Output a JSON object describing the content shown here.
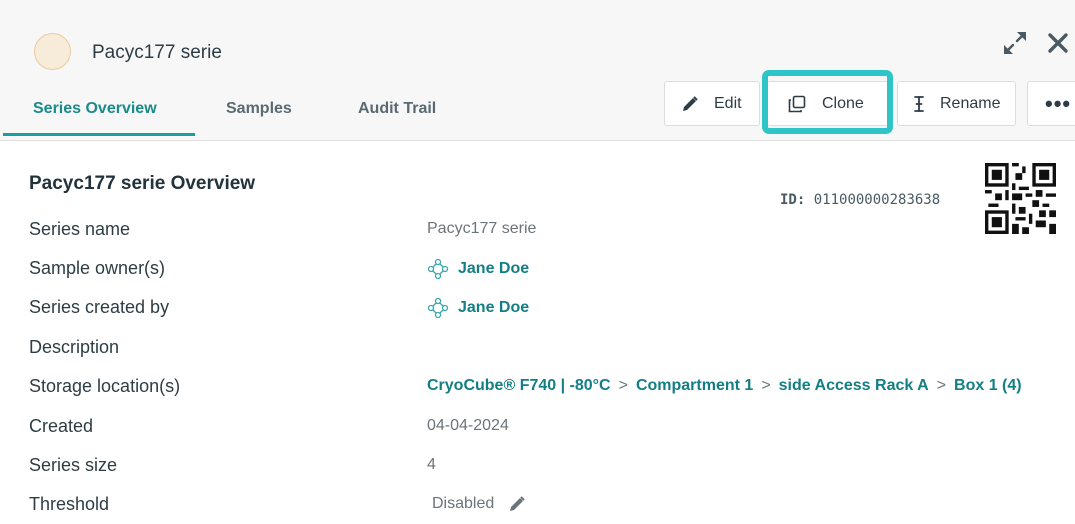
{
  "header": {
    "title": "Pacyc177 serie",
    "avatar_color": "#f7ecd9",
    "expand_icon": "expand-icon",
    "close_icon": "close-icon"
  },
  "tabs": [
    {
      "label": "Series Overview",
      "active": true
    },
    {
      "label": "Samples",
      "active": false
    },
    {
      "label": "Audit Trail",
      "active": false
    }
  ],
  "actions": {
    "edit_label": "Edit",
    "clone_label": "Clone",
    "rename_label": "Rename",
    "more_label": "•••",
    "highlight_color": "#2ec5c9"
  },
  "overview": {
    "title": "Pacyc177 serie Overview",
    "id_label": "ID:",
    "id_value": "011000000283638",
    "rows": {
      "series_name": {
        "label": "Series name",
        "value": "Pacyc177 serie"
      },
      "sample_owner": {
        "label": "Sample owner(s)",
        "value": "Jane Doe"
      },
      "created_by": {
        "label": "Series created by",
        "value": "Jane Doe"
      },
      "description": {
        "label": "Description",
        "value": ""
      },
      "storage": {
        "label": "Storage location(s)",
        "path": [
          "CryoCube® F740 | -80°C",
          "Compartment 1",
          "side Access Rack A",
          "Box 1 (4)"
        ],
        "separator": ">"
      },
      "created": {
        "label": "Created",
        "value": "04-04-2024"
      },
      "series_size": {
        "label": "Series size",
        "value": "4"
      },
      "threshold": {
        "label": "Threshold",
        "value": "Disabled"
      }
    }
  },
  "colors": {
    "accent": "#1a8a8a",
    "link": "#137f85",
    "text": "#2e3d45"
  }
}
